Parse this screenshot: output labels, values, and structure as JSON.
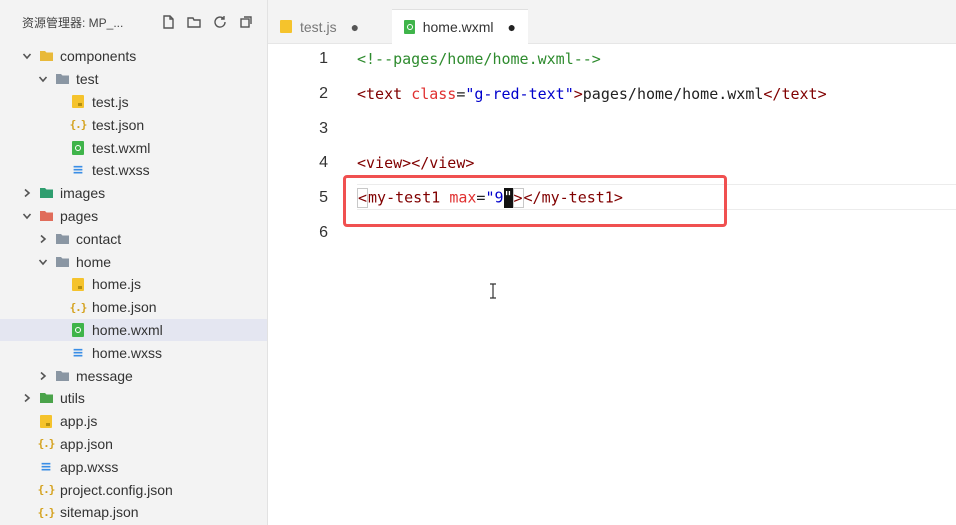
{
  "sidebar": {
    "title": "资源管理器: MP_...",
    "tree": [
      {
        "label": "components",
        "depth": 0,
        "type": "folder",
        "expanded": true,
        "icon": "components-folder-icon"
      },
      {
        "label": "test",
        "depth": 1,
        "type": "folder",
        "expanded": true,
        "icon": "folder-icon"
      },
      {
        "label": "test.js",
        "depth": 2,
        "type": "js"
      },
      {
        "label": "test.json",
        "depth": 2,
        "type": "json"
      },
      {
        "label": "test.wxml",
        "depth": 2,
        "type": "wxml"
      },
      {
        "label": "test.wxss",
        "depth": 2,
        "type": "wxss"
      },
      {
        "label": "images",
        "depth": 0,
        "type": "folder",
        "expanded": false,
        "icon": "images-folder-icon"
      },
      {
        "label": "pages",
        "depth": 0,
        "type": "folder",
        "expanded": true,
        "icon": "pages-folder-icon"
      },
      {
        "label": "contact",
        "depth": 1,
        "type": "folder",
        "expanded": false,
        "icon": "folder-icon"
      },
      {
        "label": "home",
        "depth": 1,
        "type": "folder",
        "expanded": true,
        "icon": "folder-icon"
      },
      {
        "label": "home.js",
        "depth": 2,
        "type": "js"
      },
      {
        "label": "home.json",
        "depth": 2,
        "type": "json"
      },
      {
        "label": "home.wxml",
        "depth": 2,
        "type": "wxml",
        "selected": true
      },
      {
        "label": "home.wxss",
        "depth": 2,
        "type": "wxss"
      },
      {
        "label": "message",
        "depth": 1,
        "type": "folder",
        "expanded": false,
        "icon": "folder-icon"
      },
      {
        "label": "utils",
        "depth": 0,
        "type": "folder",
        "expanded": false,
        "icon": "utils-folder-icon"
      },
      {
        "label": "app.js",
        "depth": 0,
        "type": "js"
      },
      {
        "label": "app.json",
        "depth": 0,
        "type": "json"
      },
      {
        "label": "app.wxss",
        "depth": 0,
        "type": "wxss"
      },
      {
        "label": "project.config.json",
        "depth": 0,
        "type": "json"
      },
      {
        "label": "sitemap.json",
        "depth": 0,
        "type": "json"
      }
    ]
  },
  "tabs": [
    {
      "label": "test.js",
      "active": false,
      "modified_mark": "●"
    },
    {
      "label": "home.wxml",
      "active": true,
      "modified_mark": "●"
    }
  ],
  "editor": {
    "line_numbers": [
      "1",
      "2",
      "3",
      "4",
      "5",
      "6"
    ],
    "lines": {
      "l1": {
        "comment": "<!--pages/home/home.wxml-->"
      },
      "l2": {
        "open_lt": "<",
        "tag": "text",
        "space": " ",
        "attr": "class",
        "eq": "=",
        "value": "\"g-red-text\"",
        "gt": ">",
        "content": "pages/home/home.wxml",
        "close_open": "</",
        "close_tag": "text",
        "close_gt": ">"
      },
      "l4": {
        "lt": "<",
        "tag": "view",
        "gt": ">",
        "close_open": "</",
        "close_tag": "view",
        "close_gt": ">"
      },
      "l5": {
        "lt": "<",
        "tag": "my-test1",
        "space": " ",
        "attr": "max",
        "eq": "=",
        "value_open": "\"9",
        "value_close": "\"",
        "gt": ">",
        "close_open": "</",
        "close_tag": "my-test1",
        "close_gt": ">"
      }
    }
  },
  "colors": {
    "comment": "#2e8b2e",
    "tag": "#800000",
    "attribute": "#e03030",
    "string": "#0000cc",
    "highlight_box": "#f05050",
    "selected_row": "#e4e6f1"
  }
}
